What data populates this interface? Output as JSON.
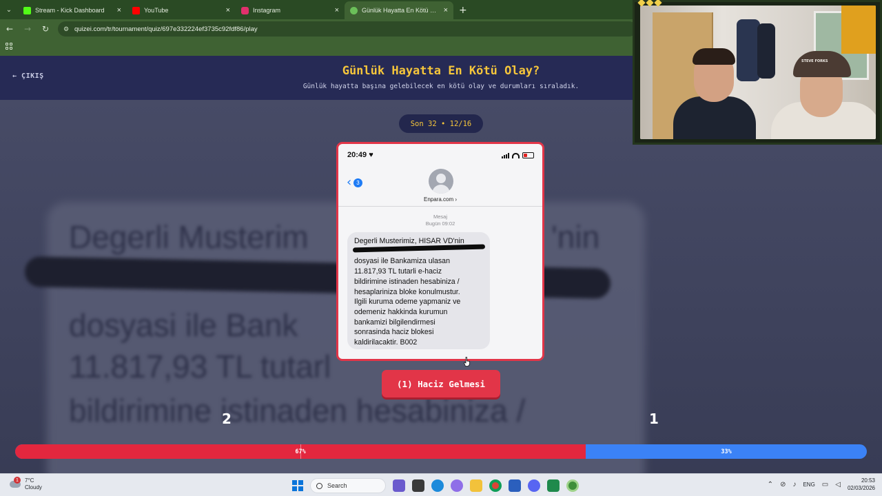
{
  "browser": {
    "tabs": [
      {
        "title": "Stream - Kick Dashboard",
        "favicon_color": "#53fc18",
        "active": false
      },
      {
        "title": "YouTube",
        "favicon_color": "#ff0000",
        "active": false
      },
      {
        "title": "Instagram",
        "favicon_color": "#e1306c",
        "active": false
      },
      {
        "title": "Günlük Hayatta En Kötü Olay?",
        "favicon_color": "#6bbf59",
        "active": true
      }
    ],
    "close_glyph": "×",
    "new_tab_glyph": "+",
    "url": "quizei.com/tr/tournament/quiz/697e332224ef3735c92fdf86/play"
  },
  "page": {
    "exit_label": "ÇIKIŞ",
    "title": "Günlük Hayatta En Kötü Olay?",
    "subtitle": "Günlük hayatta başına gelebilecek en kötü olay ve durumları sıraladık.",
    "round_label": "Son 32 • 12/16",
    "answer_label": "(1) Haciz Gelmesi",
    "left_score": "2",
    "right_score": "1",
    "left_percent_label": "67%",
    "right_percent_label": "33%",
    "left_vote_fraction": 0.67,
    "colors": {
      "accent_red": "#e23548",
      "accent_blue": "#3b82f6",
      "title_yellow": "#f6c63b",
      "header_navy": "#262a55"
    }
  },
  "sms": {
    "time": "20:49 ♥",
    "back_count": "3",
    "sender": "Enpara.com ›",
    "meta_line1": "Mesaj",
    "meta_line2": "Bugün 09:02",
    "lines": [
      "Degerli Musterimiz, HISAR VD'nin",
      "",
      "dosyasi ile Bankamiza ulasan",
      "11.817,93 TL tutarli  e-haciz",
      "bildirimine istinaden   hesabiniza /",
      "hesaplariniza   bloke konulmustur.",
      "Ilgili kuruma odeme yapmaniz ve",
      "odemeniz hakkinda kurumun",
      "bankamizi bilgilendirmesi",
      "sonrasinda haciz blokesi",
      "kaldirilacaktir.   B002"
    ]
  },
  "background_text": [
    "Degerli Musterim",
    "'nin",
    "dosyasi ile Bank",
    "11.817,93 TL tutarl",
    "bildirimine istinaden   hesabiniza /"
  ],
  "webcam": {
    "hat_text": "STEVE FORKS"
  },
  "taskbar": {
    "weather_badge": "1",
    "temperature": "7°C",
    "condition": "Cloudy",
    "search_label": "Search",
    "language": "ENG",
    "time": "20:53",
    "date": "02/03/2026",
    "icons": [
      "windows-start-icon",
      "search-icon",
      "widgets-icon",
      "file-explorer-icon",
      "edge-icon",
      "copilot-icon",
      "folder-icon",
      "chrome-icon",
      "store-icon",
      "discord-icon",
      "app-icon",
      "chrome-canary-icon"
    ]
  }
}
